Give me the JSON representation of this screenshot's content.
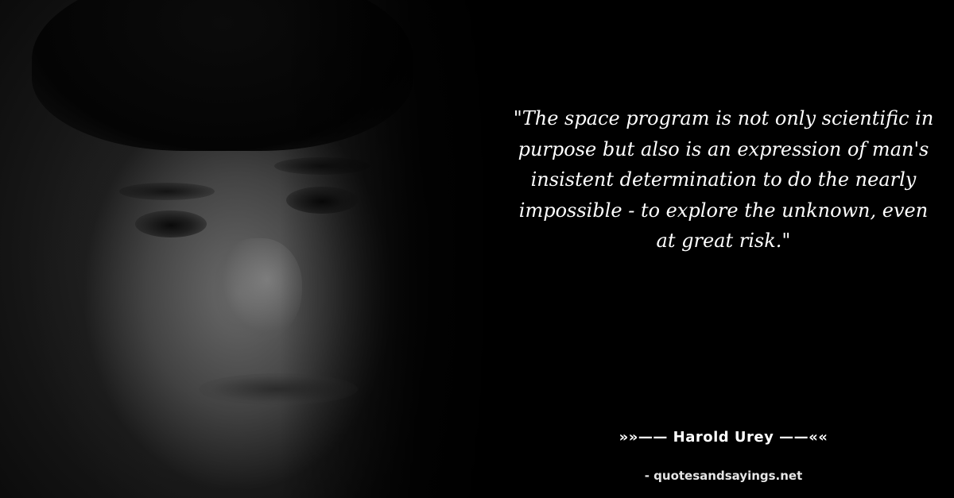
{
  "quote": {
    "text": "\"The space program is not only scientific in purpose but also is an expression of man's insistent determination to do the nearly impossible - to explore the unknown, even at great risk.\""
  },
  "author": {
    "line": "»»—— Harold Urey ——««"
  },
  "source": {
    "text": "- quotesandsayings.net"
  },
  "colors": {
    "background": "#000000",
    "text": "#ffffff"
  }
}
